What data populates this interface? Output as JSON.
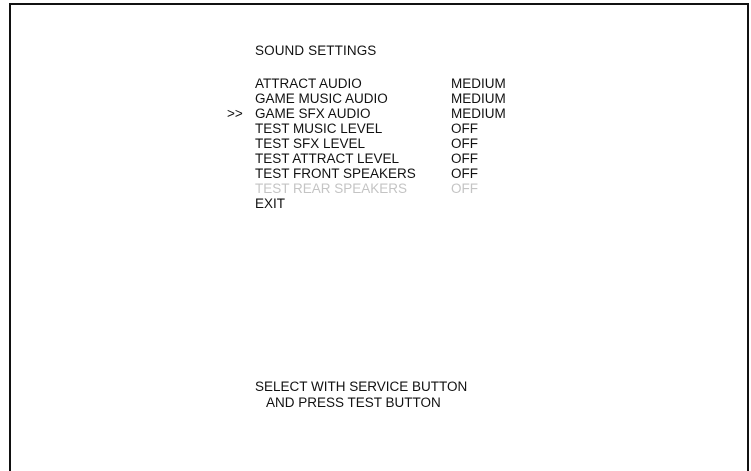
{
  "title": "SOUND SETTINGS",
  "cursor": ">>",
  "menu": [
    {
      "label": "ATTRACT AUDIO",
      "value": "MEDIUM",
      "selected": false,
      "disabled": false
    },
    {
      "label": "GAME MUSIC AUDIO",
      "value": "MEDIUM",
      "selected": false,
      "disabled": false
    },
    {
      "label": "GAME SFX AUDIO",
      "value": "MEDIUM",
      "selected": true,
      "disabled": false
    },
    {
      "label": "TEST MUSIC LEVEL",
      "value": "OFF",
      "selected": false,
      "disabled": false
    },
    {
      "label": "TEST SFX LEVEL",
      "value": "OFF",
      "selected": false,
      "disabled": false
    },
    {
      "label": "TEST ATTRACT LEVEL",
      "value": "OFF",
      "selected": false,
      "disabled": false
    },
    {
      "label": "TEST FRONT SPEAKERS",
      "value": "OFF",
      "selected": false,
      "disabled": false
    },
    {
      "label": "TEST REAR SPEAKERS",
      "value": "OFF",
      "selected": false,
      "disabled": true
    },
    {
      "label": "EXIT",
      "value": "",
      "selected": false,
      "disabled": false
    }
  ],
  "footer": {
    "line1": "SELECT WITH SERVICE BUTTON",
    "line2": "AND PRESS TEST BUTTON"
  },
  "colors": {
    "text": "#111111",
    "disabled_text": "#c4c4c4",
    "background": "#ffffff",
    "border": "#111111"
  }
}
